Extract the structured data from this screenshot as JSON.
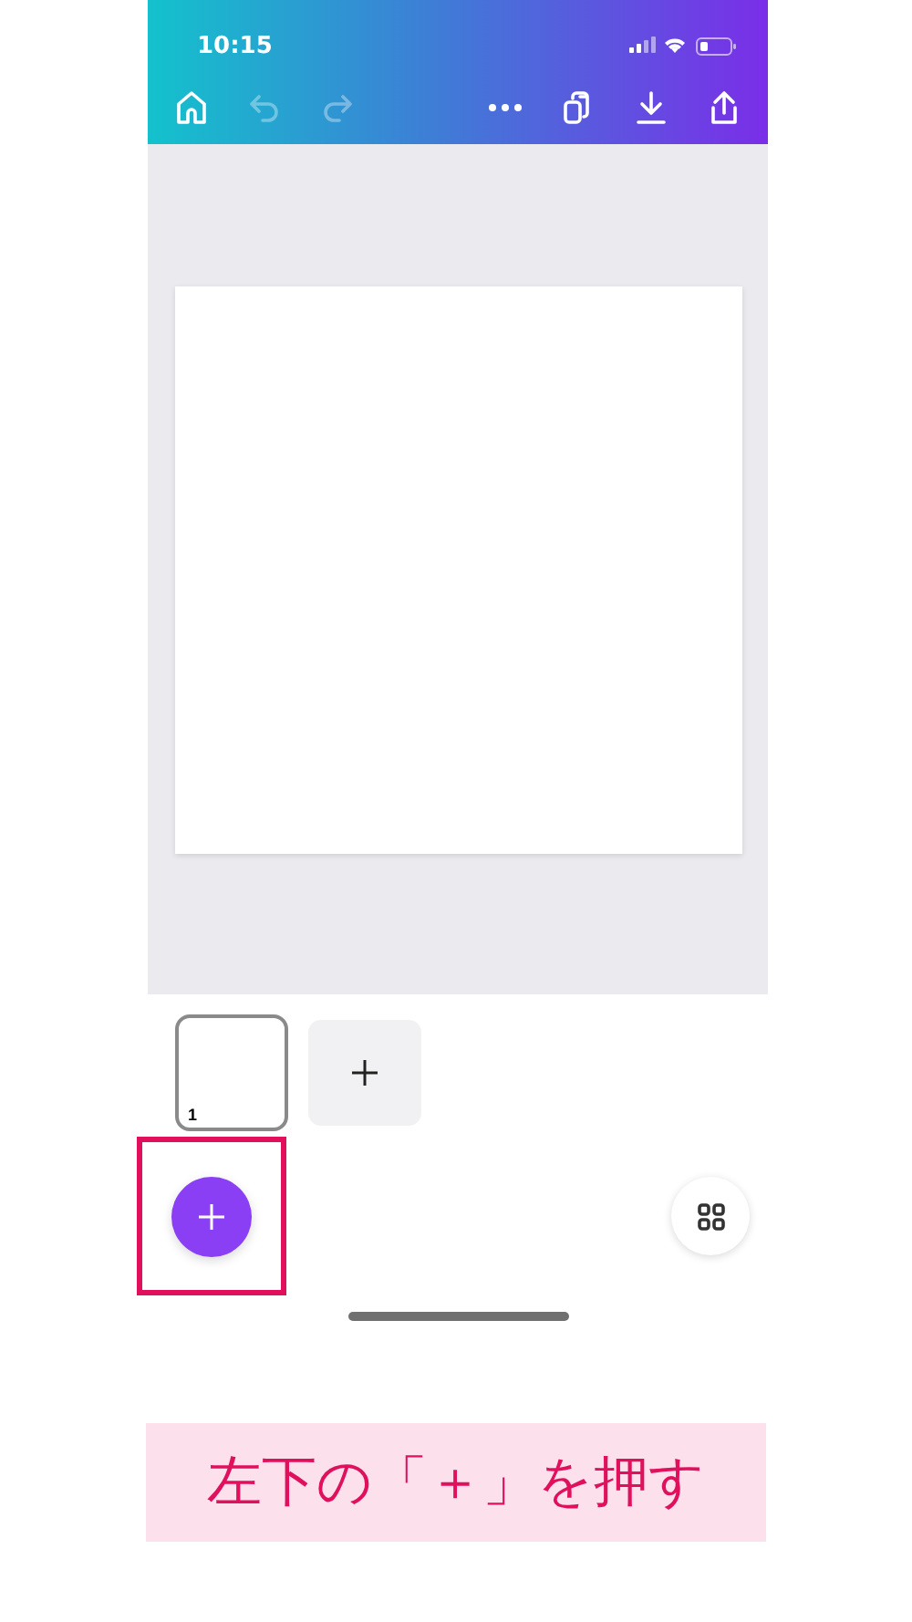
{
  "status_bar": {
    "time": "10:15"
  },
  "toolbar": {
    "left": [
      {
        "kind": "home",
        "disabled": false
      },
      {
        "kind": "undo",
        "disabled": true
      },
      {
        "kind": "redo",
        "disabled": true
      }
    ],
    "right": [
      {
        "kind": "more",
        "disabled": false
      },
      {
        "kind": "copy",
        "disabled": false
      },
      {
        "kind": "download",
        "disabled": false
      },
      {
        "kind": "share",
        "disabled": false
      }
    ]
  },
  "pages": [
    {
      "number": "1",
      "selected": true
    }
  ],
  "highlight": {
    "on": true
  },
  "caption": "左下の「＋」を押す"
}
